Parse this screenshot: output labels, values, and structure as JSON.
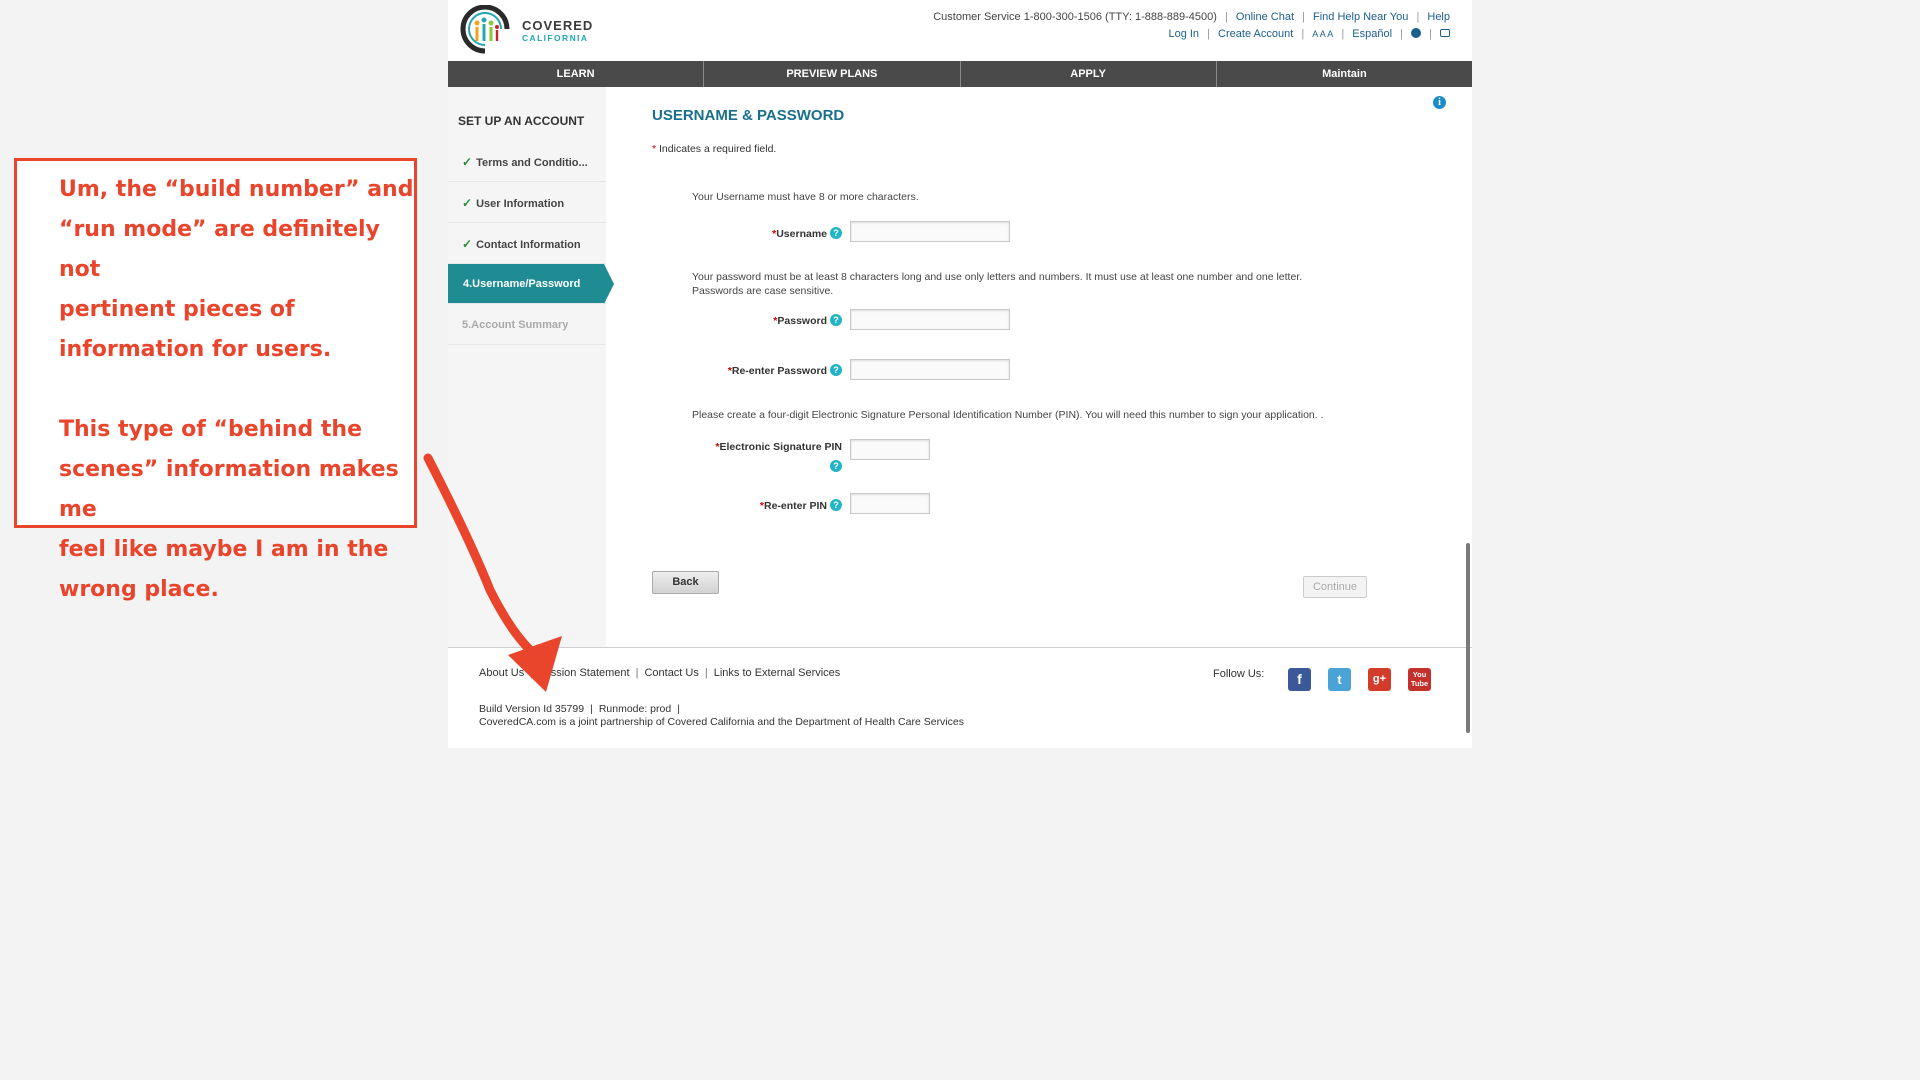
{
  "header": {
    "logo": {
      "line1": "COVERED",
      "line2": "CALIFORNIA"
    },
    "customer_service": "Customer Service 1-800-300-1506 (TTY: 1-888-889-4500)",
    "top_links_row1": [
      "Online Chat",
      "Find Help Near You",
      "Help"
    ],
    "login": "Log In",
    "create_account": "Create Account",
    "text_size": "A A A",
    "espanol": "Español"
  },
  "nav": {
    "tabs": [
      "LEARN",
      "PREVIEW PLANS",
      "APPLY",
      "Maintain"
    ]
  },
  "sidebar": {
    "title": "SET UP AN ACCOUNT",
    "steps": [
      {
        "label": "Terms and Conditio...",
        "state": "done"
      },
      {
        "label": "User Information",
        "state": "done"
      },
      {
        "label": "Contact Information",
        "state": "done"
      },
      {
        "label": "4.Username/Password",
        "state": "active"
      },
      {
        "label": "5.Account Summary",
        "state": "disabled"
      }
    ]
  },
  "form": {
    "title": "USERNAME & PASSWORD",
    "required_note": "Indicates a required field.",
    "username_hint": "Your Username must have 8 or more characters.",
    "username_label": "Username",
    "password_hint_1": "Your password must be at least 8 characters long and use only letters and numbers. It must use at least one number and one letter.",
    "password_hint_2": "Passwords are case sensitive.",
    "password_label": "Password",
    "reenter_password_label": "Re-enter Password",
    "pin_hint": "Please create a four-digit Electronic Signature Personal Identification Number (PIN). You will need this number to sign your application. .",
    "pin_label": "Electronic Signature PIN",
    "reenter_pin_label": "Re-enter PIN",
    "back_button": "Back",
    "continue_button": "Continue"
  },
  "footer": {
    "links": [
      "About Us",
      "Mission Statement",
      "Contact Us",
      "Links to External Services"
    ],
    "build_version": "Build Version Id 35799",
    "runmode": "Runmode: prod",
    "partnership": "CoveredCA.com is a joint partnership of Covered California and the Department of Health Care Services",
    "follow_us": "Follow Us:",
    "social": [
      "facebook",
      "twitter",
      "google-plus",
      "youtube"
    ]
  },
  "annotation": {
    "text": "Um, the “build number” and\n“run mode” are definitely not\npertinent pieces of\ninformation for users.\n\nThis type of “behind the\nscenes” information makes me\nfeel like maybe I am in the\nwrong place.",
    "color": "#e8452c"
  },
  "colors": {
    "accent_teal": "#1f8c94",
    "nav_bg": "#4a4a4a",
    "annotation_red": "#e8452c"
  }
}
